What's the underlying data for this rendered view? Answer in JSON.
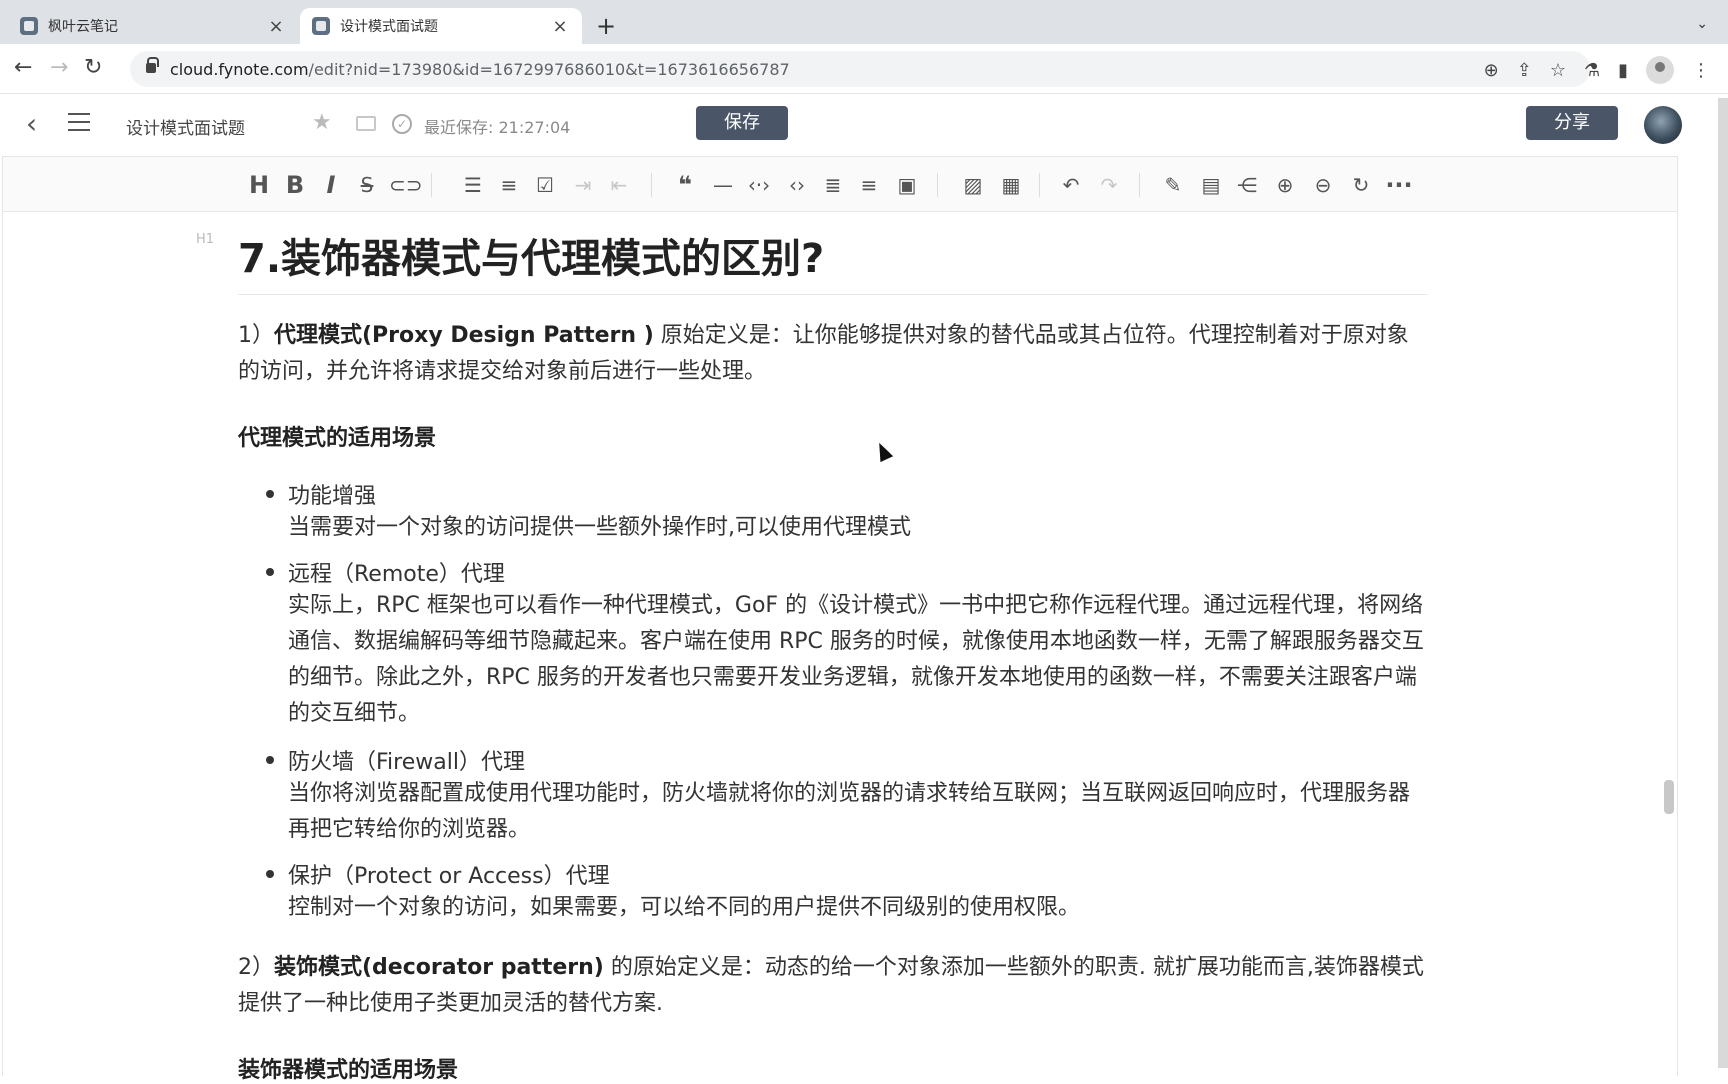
{
  "browser": {
    "tabs": [
      {
        "label": "枫叶云笔记"
      },
      {
        "label": "设计模式面试题"
      }
    ],
    "url_host": "cloud.fynote.com",
    "url_path": "/edit?nid=173980&id=1672997686010&t=1673616656787"
  },
  "app": {
    "doc_title": "设计模式面试题",
    "save_status": "最近保存: 21:27:04",
    "save_label": "保存",
    "share_label": "分享"
  },
  "toolbar": {
    "heading": "H",
    "bold": "B",
    "italic": "I",
    "strike": "S",
    "more": "···"
  },
  "content": {
    "h1_marker": "H1",
    "heading": "7.装饰器模式与代理模式的区别?",
    "p1_prefix": "1）",
    "p1_bold": "代理模式(Proxy Design Pattern )",
    "p1_text": " 原始定义是：让你能够提供对象的替代品或其占位符。代理控制着对于原对象的访问，并允许将请求提交给对象前后进行一些处理。",
    "proxy_scenes_title": "代理模式的适用场景",
    "items": [
      {
        "title": "功能增强",
        "desc": "当需要对一个对象的访问提供一些额外操作时,可以使用代理模式"
      },
      {
        "title": "远程（Remote）代理",
        "desc": "实际上，RPC 框架也可以看作一种代理模式，GoF 的《设计模式》一书中把它称作远程代理。通过远程代理，将网络通信、数据编解码等细节隐藏起来。客户端在使用 RPC 服务的时候，就像使用本地函数一样，无需了解跟服务器交互的细节。除此之外，RPC 服务的开发者也只需要开发业务逻辑，就像开发本地使用的函数一样，不需要关注跟客户端的交互细节。"
      },
      {
        "title": "防火墙（Firewall）代理",
        "desc": "当你将浏览器配置成使用代理功能时，防火墙就将你的浏览器的请求转给互联网；当互联网返回响应时，代理服务器再把它转给你的浏览器。"
      },
      {
        "title": "保护（Protect or Access）代理",
        "desc": "控制对一个对象的访问，如果需要，可以给不同的用户提供不同级别的使用权限。"
      }
    ],
    "p2_prefix": "2）",
    "p2_bold": "装饰模式(decorator pattern)",
    "p2_text": " 的原始定义是：动态的给一个对象添加一些额外的职责. 就扩展功能而言,装饰器模式提供了一种比使用子类更加灵活的替代方案.",
    "decorator_scenes_title": "装饰器模式的适用场景"
  }
}
